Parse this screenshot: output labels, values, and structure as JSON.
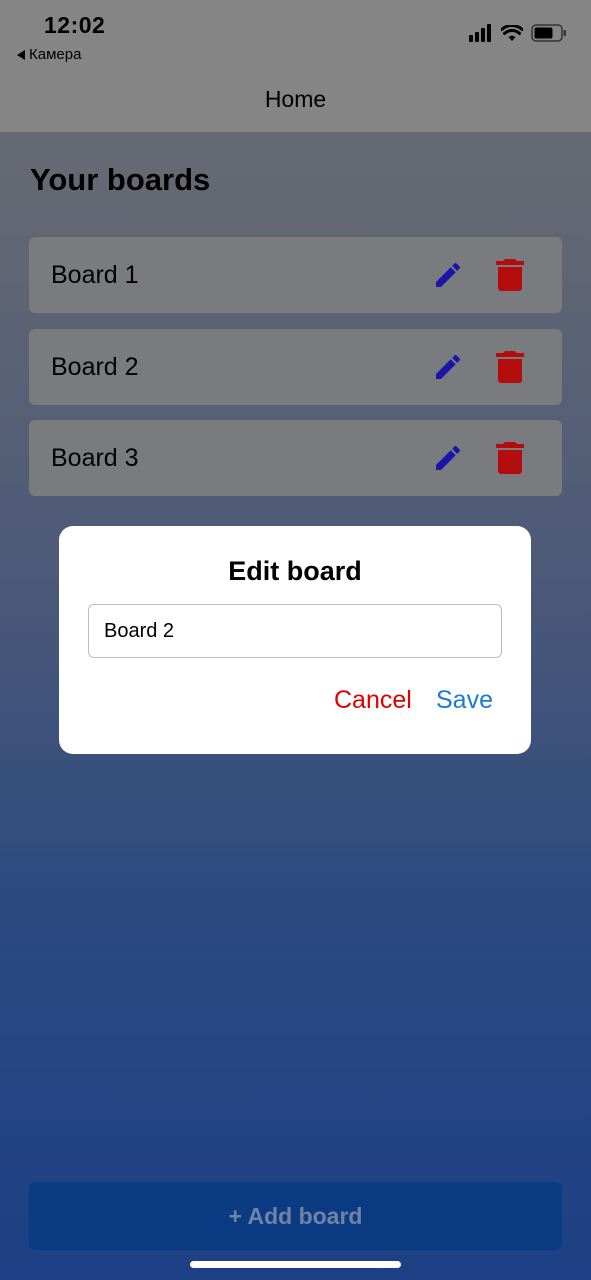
{
  "status_bar": {
    "time": "12:02",
    "back_app": "Камера"
  },
  "header": {
    "title": "Home"
  },
  "main": {
    "heading": "Your boards",
    "boards": [
      {
        "label": "Board 1"
      },
      {
        "label": "Board 2"
      },
      {
        "label": "Board 3"
      }
    ],
    "add_button_label": "+ Add board"
  },
  "modal": {
    "title": "Edit board",
    "input_value": "Board 2",
    "cancel_label": "Cancel",
    "save_label": "Save"
  },
  "colors": {
    "edit_icon": "#1a17a8",
    "delete_icon": "#b30d0d",
    "cancel": "#e00000",
    "save": "#1a7ad8"
  },
  "icons": {
    "edit": "pencil-icon",
    "delete": "trash-icon"
  }
}
